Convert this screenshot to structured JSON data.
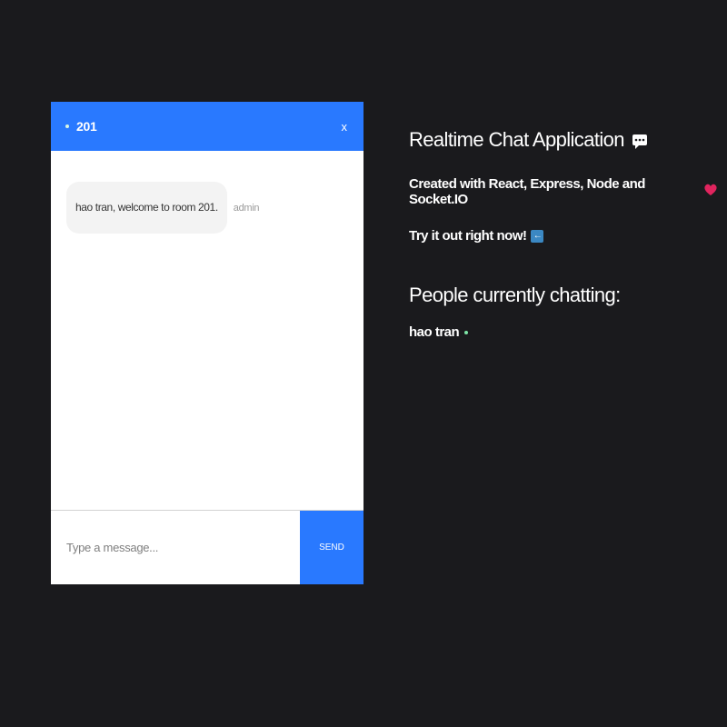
{
  "chat": {
    "room_name": "201",
    "close_label": "x",
    "messages": [
      {
        "text": "hao tran, welcome to room 201.",
        "sender": "admin"
      }
    ],
    "input_placeholder": "Type a message...",
    "send_label": "SEND"
  },
  "info": {
    "title": "Realtime Chat Application",
    "title_icon": "speech-balloon-icon",
    "created_with": "Created with React, Express, Node and Socket.IO",
    "created_icon": "heart-icon",
    "try_it": "Try it out right now!",
    "try_icon": "left-arrow-icon",
    "people_title": "People currently chatting:",
    "people": [
      "hao tran"
    ]
  },
  "colors": {
    "background": "#1a1a1d",
    "accent": "#2979ff",
    "online": "#7ee6a7",
    "heart": "#e0245e"
  }
}
